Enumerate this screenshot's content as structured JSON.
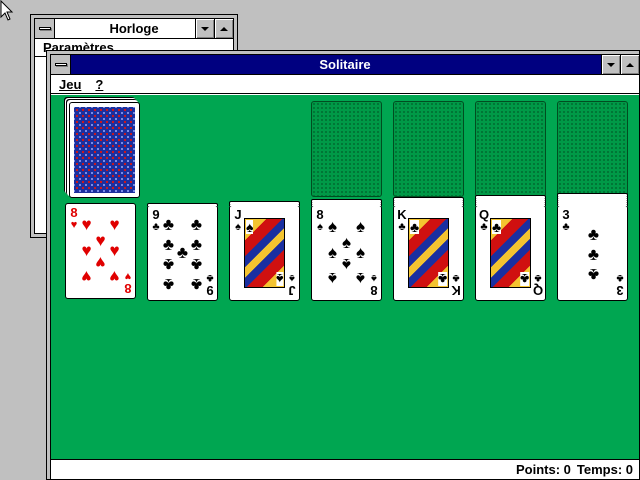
{
  "horloge": {
    "title": "Horloge",
    "menu": "Paramètres"
  },
  "solitaire": {
    "title": "Solitaire",
    "menu": [
      "Jeu",
      "?"
    ],
    "status": {
      "points_label": "Points: 0",
      "time_label": "Temps: 0"
    },
    "tableau": [
      {
        "rank": "8",
        "suit": "♥",
        "color": "#e00000"
      },
      {
        "rank": "9",
        "suit": "♣",
        "color": "#000000"
      },
      {
        "rank": "J",
        "suit": "♠",
        "color": "#000000"
      },
      {
        "rank": "8",
        "suit": "♠",
        "color": "#000000"
      },
      {
        "rank": "K",
        "suit": "♣",
        "color": "#000000"
      },
      {
        "rank": "Q",
        "suit": "♣",
        "color": "#000000"
      },
      {
        "rank": "3",
        "suit": "♣",
        "color": "#000000"
      }
    ]
  },
  "colors": {
    "felt": "#00a651",
    "active_title": "#000080",
    "card_back": "#1b2f9e"
  }
}
